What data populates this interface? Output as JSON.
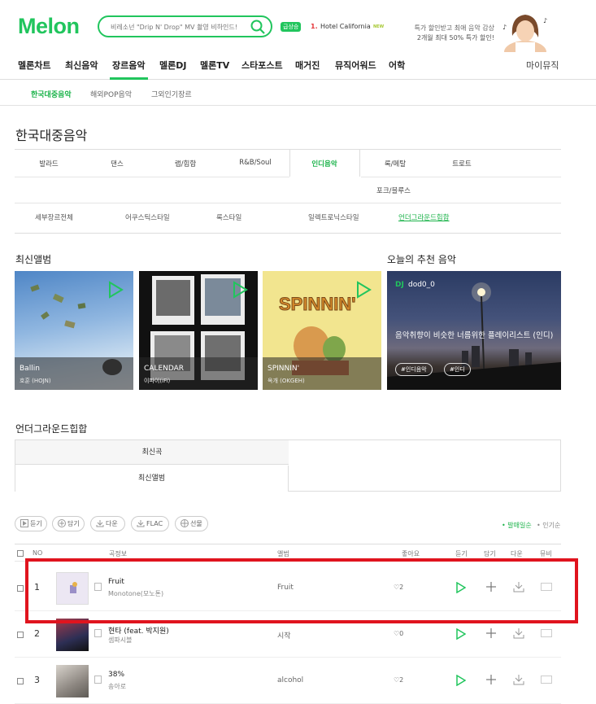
{
  "header": {
    "logo": "Melon",
    "search_placeholder": "비레소넌 \"Drip N' Drop\" MV 촬영 비하인드!",
    "rank_badge": "급상승",
    "rank_number": "1.",
    "rank_title": "Hotel California",
    "rank_new": "NEW",
    "ad_line1": "특가 할인받고 최애 음악 감상",
    "ad_line2": "2개월 최대 50% 특가 할인!"
  },
  "gnb": {
    "items": [
      "멜론차트",
      "최신음악",
      "장르음악",
      "멜론DJ",
      "멜론TV",
      "스타포스트",
      "매거진",
      "뮤직어워드",
      "어학"
    ],
    "my_music": "마이뮤직"
  },
  "subnav": [
    "한국대중음악",
    "해외POP음악",
    "그외인기장르"
  ],
  "page_title": "한국대중음악",
  "genres": {
    "row1": [
      "발라드",
      "댄스",
      "랩/힙합",
      "R&B/Soul",
      "인디음악",
      "록/메탈",
      "트로트"
    ],
    "row2": [
      "포크/블루스"
    ],
    "sub": [
      "세부장르전체",
      "어쿠스틱스타일",
      "록스타일",
      "일렉트로닉스타일",
      "언더그라운드힙합"
    ]
  },
  "sections": {
    "latest_albums": "최신앨범",
    "recommend": "오늘의 추천 음악",
    "underground": "언더그라운드힙합"
  },
  "albums": [
    {
      "title": "Ballin",
      "artist": "호훈 (HOJN)"
    },
    {
      "title": "CALENDAR",
      "artist": "이파이(iFi)"
    },
    {
      "title": "SPINNIN'",
      "artist": "옥개 (OKGEH)",
      "cover_text": "SPINNIN'"
    }
  ],
  "dj": {
    "badge": "DJ",
    "name": "dod0_0",
    "desc": "음악취향이 비슷한 너름위한 플레이리스트 (인디)",
    "tags": [
      "#인디음악",
      "#인디"
    ]
  },
  "tabs": [
    "최신곡",
    "최신앨범"
  ],
  "actions": [
    "듣기",
    "담기",
    "다운",
    "FLAC",
    "선물"
  ],
  "sort": [
    "발매일순",
    "인기순"
  ],
  "table_headers": [
    "NO",
    "곡정보",
    "앨범",
    "좋아요",
    "듣기",
    "담기",
    "다운",
    "뮤비"
  ],
  "rows": [
    {
      "rank": "1",
      "song": "Fruit",
      "artist": "Monotone(모노톤)",
      "album": "Fruit",
      "likes": "2"
    },
    {
      "rank": "2",
      "song": "현타 (feat. 박지원)",
      "artist": "셈파시블",
      "album": "시작",
      "likes": "0"
    },
    {
      "rank": "3",
      "song": "38%",
      "artist": "송아로",
      "album": "alcohol",
      "likes": "2"
    }
  ],
  "colors": {
    "accent": "#21c55d",
    "highlight": "#e0141e"
  }
}
